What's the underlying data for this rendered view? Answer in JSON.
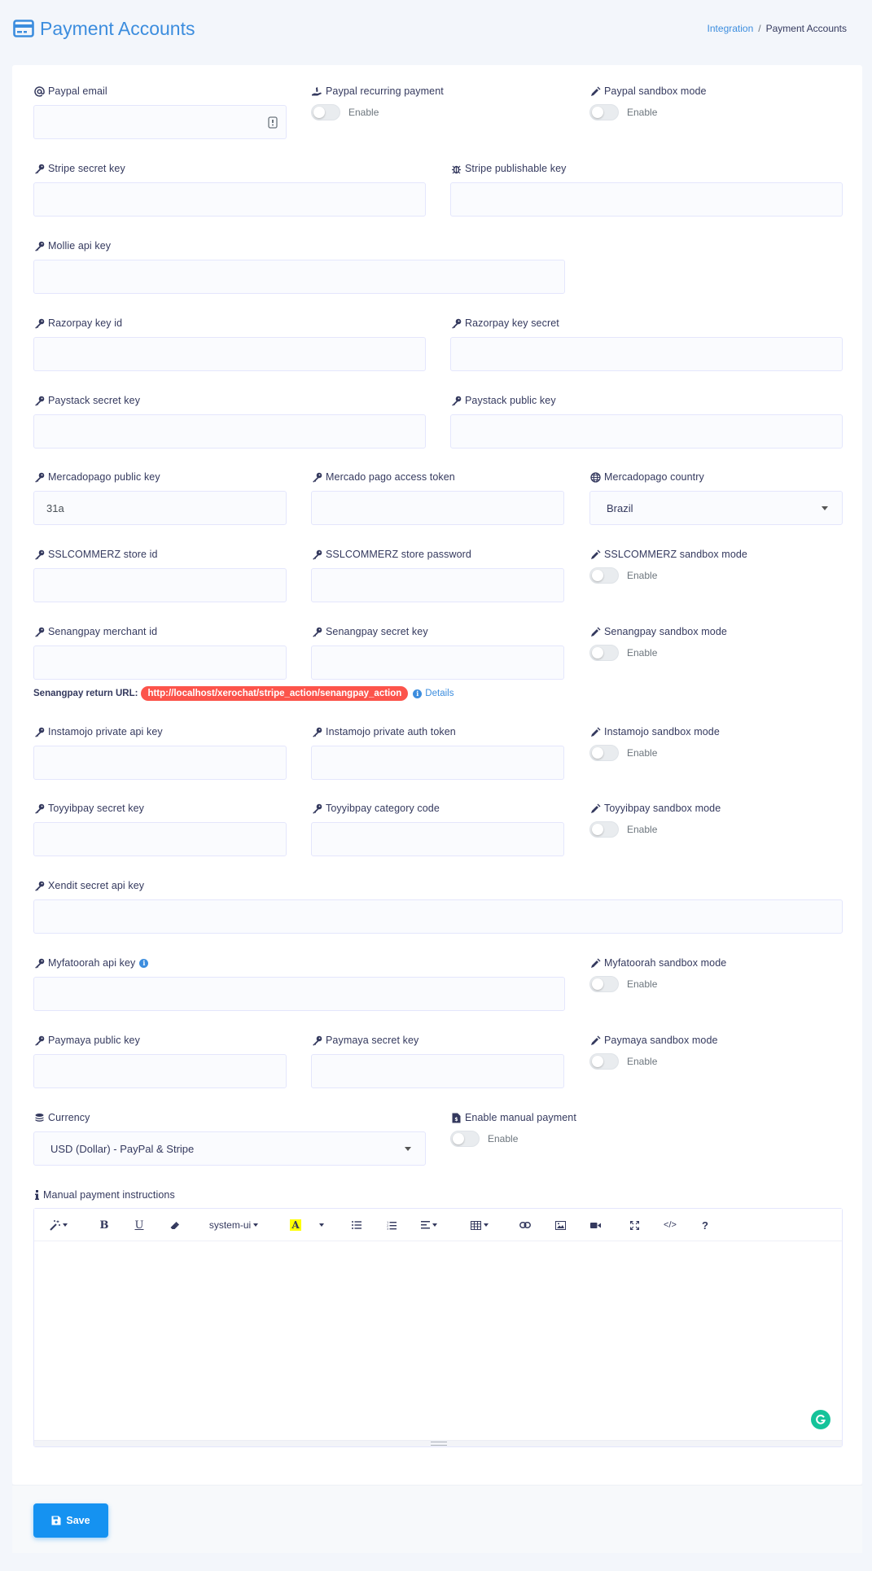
{
  "header": {
    "title": "Payment Accounts",
    "breadcrumb": {
      "link": "Integration",
      "separator": "/",
      "current": "Payment Accounts"
    }
  },
  "fields": {
    "paypal_email": {
      "label": "Paypal email",
      "value": ""
    },
    "paypal_recurring": {
      "label": "Paypal recurring payment",
      "toggle": "Enable"
    },
    "paypal_sandbox": {
      "label": "Paypal sandbox mode",
      "toggle": "Enable"
    },
    "stripe_secret": {
      "label": "Stripe secret key",
      "value": ""
    },
    "stripe_publishable": {
      "label": "Stripe publishable key",
      "value": ""
    },
    "mollie_api": {
      "label": "Mollie api key",
      "value": ""
    },
    "razorpay_id": {
      "label": "Razorpay key id",
      "value": ""
    },
    "razorpay_secret": {
      "label": "Razorpay key secret",
      "value": ""
    },
    "paystack_secret": {
      "label": "Paystack secret key",
      "value": ""
    },
    "paystack_public": {
      "label": "Paystack public key",
      "value": ""
    },
    "mercadopago_public": {
      "label": "Mercadopago public key",
      "value": "31a"
    },
    "mercadopago_token": {
      "label": "Mercado pago access token",
      "value": ""
    },
    "mercadopago_country": {
      "label": "Mercadopago country",
      "value": "Brazil"
    },
    "sslcommerz_store_id": {
      "label": "SSLCOMMERZ store id",
      "value": ""
    },
    "sslcommerz_store_password": {
      "label": "SSLCOMMERZ store password",
      "value": ""
    },
    "sslcommerz_sandbox": {
      "label": "SSLCOMMERZ sandbox mode",
      "toggle": "Enable"
    },
    "senangpay_merchant": {
      "label": "Senangpay merchant id",
      "value": ""
    },
    "senangpay_secret": {
      "label": "Senangpay secret key",
      "value": ""
    },
    "senangpay_sandbox": {
      "label": "Senangpay sandbox mode",
      "toggle": "Enable"
    },
    "instamojo_api": {
      "label": "Instamojo private api key",
      "value": ""
    },
    "instamojo_auth": {
      "label": "Instamojo private auth token",
      "value": ""
    },
    "instamojo_sandbox": {
      "label": "Instamojo sandbox mode",
      "toggle": "Enable"
    },
    "toyyibpay_secret": {
      "label": "Toyyibpay secret key",
      "value": ""
    },
    "toyyibpay_category": {
      "label": "Toyyibpay category code",
      "value": ""
    },
    "toyyibpay_sandbox": {
      "label": "Toyyibpay sandbox mode",
      "toggle": "Enable"
    },
    "xendit_secret": {
      "label": "Xendit secret api key",
      "value": ""
    },
    "myfatoorah_api": {
      "label": "Myfatoorah api key",
      "value": ""
    },
    "myfatoorah_sandbox": {
      "label": "Myfatoorah sandbox mode",
      "toggle": "Enable"
    },
    "paymaya_public": {
      "label": "Paymaya public key",
      "value": ""
    },
    "paymaya_secret": {
      "label": "Paymaya secret key",
      "value": ""
    },
    "paymaya_sandbox": {
      "label": "Paymaya sandbox mode",
      "toggle": "Enable"
    },
    "currency": {
      "label": "Currency",
      "value": "USD (Dollar) - PayPal & Stripe"
    },
    "manual_payment": {
      "label": "Enable manual payment",
      "toggle": "Enable"
    },
    "manual_instructions": {
      "label": "Manual payment instructions"
    }
  },
  "senangpay_return": {
    "label": "Senangpay return URL:",
    "url": "http://localhost/xerochat/stripe_action/senangpay_action",
    "details": "Details"
  },
  "editor": {
    "font_name": "system-ui",
    "bold": "B",
    "underline": "U",
    "highlight": "A",
    "help": "?",
    "code": "</>"
  },
  "footer": {
    "save_label": "Save"
  },
  "colors": {
    "accent": "#3c8dde",
    "primary_button": "#1592f1",
    "danger_badge": "#fc544b",
    "grammarly": "#15c39a"
  }
}
